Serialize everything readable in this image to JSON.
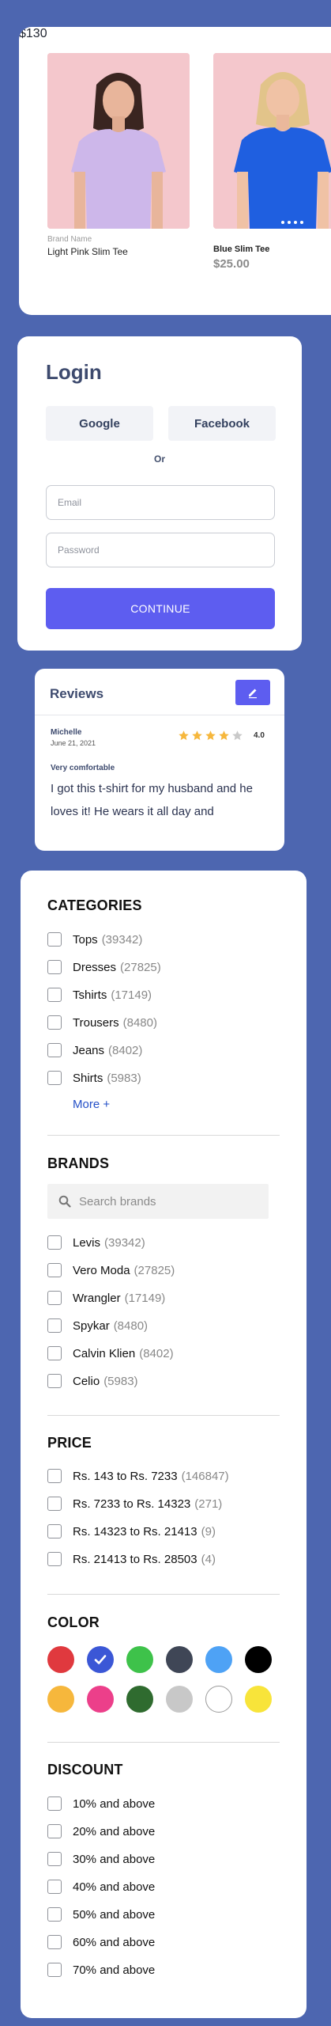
{
  "products": [
    {
      "brand": "Brand Name",
      "name": "Light Pink Slim Tee",
      "price": "$130"
    },
    {
      "brand": "",
      "name": "Blue Slim Tee",
      "price": "$25.00"
    }
  ],
  "login": {
    "title": "Login",
    "google": "Google",
    "facebook": "Facebook",
    "or": "Or",
    "email_placeholder": "Email",
    "password_placeholder": "Password",
    "continue": "CONTINUE"
  },
  "reviews": {
    "title": "Reviews",
    "reviewer": "Michelle",
    "date": "June 21, 2021",
    "rating": "4.0",
    "stars_filled": 4,
    "stars_total": 5,
    "review_title": "Very comfortable",
    "body": "I got this t-shirt for my husband and he loves it! He wears it all day and"
  },
  "filters": {
    "categories": {
      "title": "CATEGORIES",
      "items": [
        {
          "label": "Tops",
          "count": "(39342)"
        },
        {
          "label": "Dresses",
          "count": "(27825)"
        },
        {
          "label": "Tshirts",
          "count": "(17149)"
        },
        {
          "label": "Trousers",
          "count": "(8480)"
        },
        {
          "label": "Jeans",
          "count": "(8402)"
        },
        {
          "label": "Shirts",
          "count": "(5983)"
        }
      ],
      "more": "More +"
    },
    "brands": {
      "title": "BRANDS",
      "search_placeholder": "Search brands",
      "items": [
        {
          "label": "Levis",
          "count": "(39342)"
        },
        {
          "label": "Vero Moda",
          "count": "(27825)"
        },
        {
          "label": "Wrangler",
          "count": "(17149)"
        },
        {
          "label": "Spykar",
          "count": "(8480)"
        },
        {
          "label": "Calvin Klien",
          "count": "(8402)"
        },
        {
          "label": "Celio",
          "count": "(5983)"
        }
      ]
    },
    "price": {
      "title": "PRICE",
      "items": [
        {
          "label": "Rs. 143 to Rs. 7233",
          "count": "(146847)"
        },
        {
          "label": "Rs. 7233 to Rs. 14323",
          "count": "(271)"
        },
        {
          "label": "Rs. 14323 to Rs. 21413",
          "count": "(9)"
        },
        {
          "label": "Rs. 21413 to Rs. 28503",
          "count": "(4)"
        }
      ]
    },
    "color": {
      "title": "COLOR",
      "swatches": [
        {
          "name": "red",
          "hex": "#e0393e",
          "selected": false
        },
        {
          "name": "blue",
          "hex": "#3b57d6",
          "selected": true
        },
        {
          "name": "green",
          "hex": "#3ec24a",
          "selected": false
        },
        {
          "name": "slate",
          "hex": "#3f4656",
          "selected": false
        },
        {
          "name": "sky-blue",
          "hex": "#4ea2f5",
          "selected": false
        },
        {
          "name": "black",
          "hex": "#000000",
          "selected": false
        },
        {
          "name": "amber",
          "hex": "#f6b73c",
          "selected": false
        },
        {
          "name": "pink",
          "hex": "#ec3f8a",
          "selected": false
        },
        {
          "name": "dark-green",
          "hex": "#2f6b2f",
          "selected": false
        },
        {
          "name": "light-gray",
          "hex": "#c8c8c8",
          "selected": false
        },
        {
          "name": "white",
          "hex": "#ffffff",
          "selected": false
        },
        {
          "name": "yellow",
          "hex": "#f8e43a",
          "selected": false
        }
      ]
    },
    "discount": {
      "title": "DISCOUNT",
      "items": [
        {
          "label": "10% and above"
        },
        {
          "label": "20% and above"
        },
        {
          "label": "30% and above"
        },
        {
          "label": "40% and above"
        },
        {
          "label": "50% and above"
        },
        {
          "label": "60% and above"
        },
        {
          "label": "70% and above"
        }
      ]
    }
  },
  "theme": {
    "background": "#4d66b0",
    "accent": "#5d5df0",
    "star": "#f6b73c"
  }
}
